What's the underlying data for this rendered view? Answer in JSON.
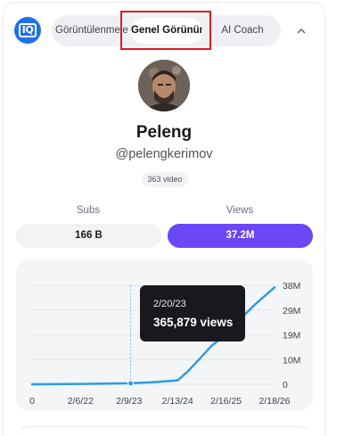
{
  "header": {
    "tabs": [
      {
        "label": "Görüntülenmeler"
      },
      {
        "label": "Genel Görünüm"
      },
      {
        "label": "AI Coach"
      }
    ],
    "active_tab": "Genel Görünüm",
    "logo_text": "IQ"
  },
  "profile": {
    "name": "Peleng",
    "handle": "@pelengkerimov",
    "video_count": "363 video"
  },
  "stats": {
    "subs_label": "Subs",
    "subs_value": "166 B",
    "views_label": "Views",
    "views_value": "37.2M"
  },
  "tooltip": {
    "date": "2/20/23",
    "value": "365,879 views"
  },
  "colors": {
    "accent": "#6c47f5",
    "line": "#2e9be6",
    "highlight": "#e0191f"
  },
  "chart_data": {
    "type": "line",
    "x_tick_labels": [
      "0",
      "2/6/22",
      "2/9/23",
      "2/13/24",
      "2/16/25",
      "2/18/26"
    ],
    "y_tick_labels": [
      "0",
      "10M",
      "19M",
      "29M",
      "38M"
    ],
    "ylim": [
      0,
      38000000
    ],
    "x": [
      "2021-02-01",
      "2022-02-06",
      "2023-02-09",
      "2023-08-01",
      "2024-02-13",
      "2024-05-01",
      "2024-08-01",
      "2024-11-01",
      "2025-02-16",
      "2025-06-01",
      "2025-10-01",
      "2026-02-18"
    ],
    "series": [
      {
        "values": [
          0,
          150000,
          365879,
          800000,
          1500000,
          5000000,
          10000000,
          15000000,
          19000000,
          25000000,
          31000000,
          37200000
        ]
      }
    ],
    "highlight_point": {
      "x": "2023-02-20",
      "y": 365879
    },
    "grid": true
  }
}
